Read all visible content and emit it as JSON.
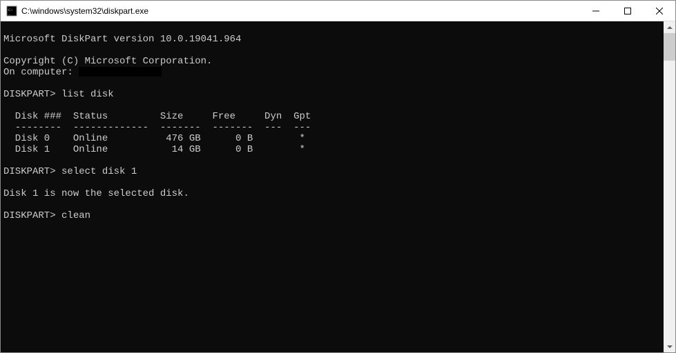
{
  "titlebar": {
    "title": "C:\\windows\\system32\\diskpart.exe"
  },
  "console": {
    "blank_top": "",
    "version_line": "Microsoft DiskPart version 10.0.19041.964",
    "blank0": "",
    "copyright_line": "Copyright (C) Microsoft Corporation.",
    "computer_prefix": "On computer: ",
    "blank1": "",
    "prompt1": "DISKPART> ",
    "cmd1": "list disk",
    "blank2": "",
    "table": {
      "header": "  Disk ###  Status         Size     Free     Dyn  Gpt",
      "divider": "  --------  -------------  -------  -------  ---  ---",
      "rows": [
        "  Disk 0    Online          476 GB      0 B        *",
        "  Disk 1    Online           14 GB      0 B        *"
      ]
    },
    "blank3": "",
    "prompt2": "DISKPART> ",
    "cmd2": "select disk 1",
    "blank4": "",
    "msg_selected": "Disk 1 is now the selected disk.",
    "blank5": "",
    "prompt3": "DISKPART> ",
    "cmd3": "clean"
  }
}
